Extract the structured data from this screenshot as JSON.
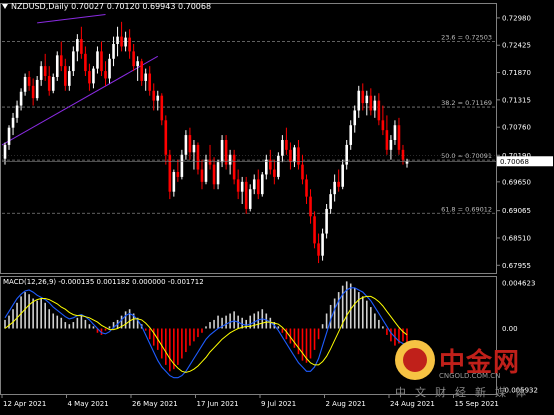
{
  "ticker": {
    "symbol": "NZDUSD,Daily",
    "open": "0.70027",
    "high": "0.70120",
    "low": "0.69943",
    "close": "0.70068"
  },
  "macd_label": "MACD(12,26,9) -0.000135 0.001182 0.000000 -0.001712",
  "colors": {
    "background": "#000000",
    "bull": "#ffffff",
    "bear": "#ff0000",
    "grid": "#808080",
    "trendline": "#8a2be2",
    "signal": "#ffff00",
    "macd_line": "#1e5cff",
    "fib": "#808080"
  },
  "price_axis": {
    "labels": [
      "0.72980",
      "0.72425",
      "0.71870",
      "0.71315",
      "0.70760",
      "0.70190",
      "0.69650",
      "0.69065",
      "0.68510",
      "0.67955"
    ],
    "current": "0.70068"
  },
  "macd_axis": {
    "labels": [
      "0.004623",
      "0.00",
      "-0.005932"
    ]
  },
  "fib_levels": [
    {
      "label": "23.6 = 0.72503"
    },
    {
      "label": "38.2 = 0.71169"
    },
    {
      "label": "50.0 = 0.70091"
    },
    {
      "label": "61.8 = 0.69012"
    }
  ],
  "date_axis": {
    "labels": [
      "12 Apr 2021",
      "4 May 2021",
      "26 May 2021",
      "17 Jun 2021",
      "9 Jul 2021",
      "2 Aug 2021",
      "24 Aug 2021",
      "15 Sep 2021"
    ]
  },
  "watermark": {
    "title": "中金网",
    "url": "CNGOLD.COM.CN",
    "tagline": "中文财经新媒体"
  },
  "chart_data": {
    "type": "candlestick",
    "symbol": "NZDUSD",
    "timeframe": "Daily",
    "ylim": [
      0.679,
      0.731
    ],
    "x": [
      "12 Apr 2021",
      "4 May 2021",
      "26 May 2021",
      "17 Jun 2021",
      "9 Jul 2021",
      "2 Aug 2021",
      "24 Aug 2021",
      "15 Sep 2021"
    ],
    "candles": [
      [
        0.7012,
        0.7045,
        0.7,
        0.704
      ],
      [
        0.704,
        0.708,
        0.703,
        0.7075
      ],
      [
        0.7075,
        0.7105,
        0.706,
        0.7095
      ],
      [
        0.7095,
        0.713,
        0.7085,
        0.712
      ],
      [
        0.712,
        0.7155,
        0.711,
        0.7148
      ],
      [
        0.7148,
        0.7185,
        0.714,
        0.7178
      ],
      [
        0.7178,
        0.719,
        0.715,
        0.716
      ],
      [
        0.716,
        0.7175,
        0.712,
        0.7135
      ],
      [
        0.7135,
        0.718,
        0.713,
        0.7172
      ],
      [
        0.7172,
        0.721,
        0.716,
        0.72
      ],
      [
        0.72,
        0.7225,
        0.717,
        0.718
      ],
      [
        0.718,
        0.72,
        0.714,
        0.715
      ],
      [
        0.715,
        0.7185,
        0.7145,
        0.7178
      ],
      [
        0.7178,
        0.723,
        0.717,
        0.7222
      ],
      [
        0.7222,
        0.725,
        0.719,
        0.72
      ],
      [
        0.72,
        0.7215,
        0.715,
        0.716
      ],
      [
        0.716,
        0.72,
        0.715,
        0.719
      ],
      [
        0.719,
        0.724,
        0.718,
        0.723
      ],
      [
        0.723,
        0.7265,
        0.721,
        0.7255
      ],
      [
        0.7255,
        0.728,
        0.7215,
        0.7225
      ],
      [
        0.7225,
        0.724,
        0.718,
        0.719
      ],
      [
        0.719,
        0.7205,
        0.715,
        0.7165
      ],
      [
        0.7165,
        0.72,
        0.7155,
        0.7195
      ],
      [
        0.7195,
        0.724,
        0.7185,
        0.723
      ],
      [
        0.723,
        0.725,
        0.718,
        0.719
      ],
      [
        0.719,
        0.721,
        0.716,
        0.7175
      ],
      [
        0.7175,
        0.7225,
        0.7165,
        0.7215
      ],
      [
        0.7215,
        0.726,
        0.72,
        0.7245
      ],
      [
        0.7245,
        0.728,
        0.722,
        0.726
      ],
      [
        0.726,
        0.729,
        0.723,
        0.724
      ],
      [
        0.724,
        0.727,
        0.723,
        0.7258
      ],
      [
        0.7258,
        0.7275,
        0.7215,
        0.723
      ],
      [
        0.723,
        0.7245,
        0.719,
        0.72
      ],
      [
        0.72,
        0.722,
        0.717,
        0.721
      ],
      [
        0.721,
        0.7215,
        0.716,
        0.717
      ],
      [
        0.717,
        0.7195,
        0.715,
        0.7185
      ],
      [
        0.7185,
        0.72,
        0.714,
        0.715
      ],
      [
        0.715,
        0.7165,
        0.711,
        0.713
      ],
      [
        0.713,
        0.715,
        0.711,
        0.714
      ],
      [
        0.714,
        0.7145,
        0.708,
        0.709
      ],
      [
        0.709,
        0.71,
        0.7,
        0.702
      ],
      [
        0.702,
        0.703,
        0.693,
        0.6945
      ],
      [
        0.6945,
        0.699,
        0.6935,
        0.6985
      ],
      [
        0.6985,
        0.701,
        0.6965,
        0.6975
      ],
      [
        0.6975,
        0.703,
        0.697,
        0.702
      ],
      [
        0.702,
        0.707,
        0.701,
        0.706
      ],
      [
        0.706,
        0.7075,
        0.701,
        0.7025
      ],
      [
        0.7025,
        0.705,
        0.699,
        0.704
      ],
      [
        0.704,
        0.7045,
        0.698,
        0.699
      ],
      [
        0.699,
        0.701,
        0.695,
        0.6965
      ],
      [
        0.6965,
        0.702,
        0.696,
        0.701
      ],
      [
        0.701,
        0.704,
        0.699,
        0.7
      ],
      [
        0.7,
        0.7015,
        0.695,
        0.696
      ],
      [
        0.696,
        0.701,
        0.695,
        0.7005
      ],
      [
        0.7005,
        0.706,
        0.6995,
        0.705
      ],
      [
        0.705,
        0.706,
        0.699,
        0.7
      ],
      [
        0.7,
        0.703,
        0.698,
        0.702
      ],
      [
        0.702,
        0.703,
        0.696,
        0.697
      ],
      [
        0.697,
        0.699,
        0.693,
        0.6945
      ],
      [
        0.6945,
        0.6975,
        0.692,
        0.6965
      ],
      [
        0.6965,
        0.6975,
        0.69,
        0.691
      ],
      [
        0.691,
        0.696,
        0.6905,
        0.695
      ],
      [
        0.695,
        0.698,
        0.694,
        0.697
      ],
      [
        0.697,
        0.699,
        0.693,
        0.694
      ],
      [
        0.694,
        0.6985,
        0.6935,
        0.698
      ],
      [
        0.698,
        0.702,
        0.697,
        0.701
      ],
      [
        0.701,
        0.703,
        0.698,
        0.699
      ],
      [
        0.699,
        0.701,
        0.696,
        0.6975
      ],
      [
        0.6975,
        0.7025,
        0.697,
        0.7018
      ],
      [
        0.7018,
        0.706,
        0.7005,
        0.705
      ],
      [
        0.705,
        0.7075,
        0.702,
        0.703
      ],
      [
        0.703,
        0.7045,
        0.699,
        0.7005
      ],
      [
        0.7005,
        0.704,
        0.6995,
        0.7035
      ],
      [
        0.7035,
        0.705,
        0.699,
        0.7
      ],
      [
        0.7,
        0.702,
        0.696,
        0.697
      ],
      [
        0.697,
        0.698,
        0.692,
        0.6935
      ],
      [
        0.6935,
        0.695,
        0.688,
        0.6895
      ],
      [
        0.6895,
        0.6905,
        0.683,
        0.684
      ],
      [
        0.684,
        0.686,
        0.68,
        0.6815
      ],
      [
        0.6815,
        0.687,
        0.6805,
        0.686
      ],
      [
        0.686,
        0.692,
        0.685,
        0.691
      ],
      [
        0.691,
        0.695,
        0.69,
        0.694
      ],
      [
        0.694,
        0.698,
        0.6925,
        0.6965
      ],
      [
        0.6965,
        0.699,
        0.6945,
        0.6955
      ],
      [
        0.6955,
        0.701,
        0.695,
        0.7
      ],
      [
        0.7,
        0.705,
        0.699,
        0.704
      ],
      [
        0.704,
        0.709,
        0.703,
        0.708
      ],
      [
        0.708,
        0.712,
        0.7065,
        0.711
      ],
      [
        0.711,
        0.716,
        0.7095,
        0.715
      ],
      [
        0.715,
        0.7165,
        0.711,
        0.7125
      ],
      [
        0.7125,
        0.715,
        0.71,
        0.714
      ],
      [
        0.714,
        0.7155,
        0.71,
        0.711
      ],
      [
        0.711,
        0.714,
        0.7095,
        0.713
      ],
      [
        0.713,
        0.7145,
        0.708,
        0.709
      ],
      [
        0.709,
        0.712,
        0.706,
        0.707
      ],
      [
        0.707,
        0.71,
        0.702,
        0.703
      ],
      [
        0.703,
        0.706,
        0.701,
        0.705
      ],
      [
        0.705,
        0.709,
        0.704,
        0.708
      ],
      [
        0.708,
        0.7095,
        0.702,
        0.703
      ],
      [
        0.703,
        0.704,
        0.7,
        0.701
      ],
      [
        0.7002,
        0.7012,
        0.6994,
        0.7007
      ]
    ],
    "fib_levels": [
      {
        "ratio": 23.6,
        "value": 0.72503
      },
      {
        "ratio": 38.2,
        "value": 0.71169
      },
      {
        "ratio": 50.0,
        "value": 0.70091
      },
      {
        "ratio": 61.8,
        "value": 0.69012
      }
    ],
    "macd": {
      "params": "12,26,9",
      "ylim": [
        -0.005932,
        0.004623
      ],
      "histogram": [
        0.0008,
        0.0012,
        0.0018,
        0.0024,
        0.003,
        0.0034,
        0.0032,
        0.0028,
        0.0026,
        0.0028,
        0.0024,
        0.0018,
        0.0014,
        0.0012,
        0.001,
        0.0006,
        0.0004,
        0.0006,
        0.001,
        0.0012,
        0.0008,
        0.0004,
        0.0002,
        -0.0004,
        -0.0006,
        -0.0002,
        0.0002,
        0.0006,
        0.0008,
        0.0012,
        0.0016,
        0.0018,
        0.0014,
        0.001,
        0.0004,
        -0.0002,
        -0.001,
        -0.0016,
        -0.002,
        -0.0028,
        -0.0034,
        -0.004,
        -0.0038,
        -0.0034,
        -0.0028,
        -0.0022,
        -0.0016,
        -0.0012,
        -0.0008,
        -0.0004,
        0.0002,
        0.0006,
        0.0008,
        0.0012,
        0.001,
        0.0012,
        0.0014,
        0.0016,
        0.0012,
        0.001,
        0.0008,
        0.0012,
        0.0014,
        0.0016,
        0.0018,
        0.0014,
        0.001,
        0.0006,
        0.0002,
        -0.0004,
        -0.001,
        -0.0014,
        -0.0018,
        -0.0024,
        -0.003,
        -0.0032,
        -0.0028,
        -0.002,
        -0.001,
        0.0004,
        0.0014,
        0.0022,
        0.0028,
        0.0034,
        0.004,
        0.0044,
        0.0042,
        0.0038,
        0.0034,
        0.003,
        0.0026,
        0.002,
        0.0014,
        0.0008,
        0.0002,
        -0.0006,
        -0.0012,
        -0.0016,
        -0.0014,
        -0.0012,
        -0.0017
      ],
      "macd_line": [
        0.001,
        0.0016,
        0.0022,
        0.0028,
        0.0032,
        0.0035,
        0.0036,
        0.0034,
        0.0031,
        0.0029,
        0.0027,
        0.0024,
        0.002,
        0.0017,
        0.0014,
        0.0011,
        0.0009,
        0.001,
        0.0012,
        0.0013,
        0.0011,
        0.0008,
        0.0004,
        0.0,
        -0.0004,
        -0.0005,
        -0.0003,
        0.0001,
        0.0004,
        0.0008,
        0.0012,
        0.0014,
        0.0012,
        0.0008,
        0.0002,
        -0.0006,
        -0.0014,
        -0.0022,
        -0.003,
        -0.0036,
        -0.004,
        -0.0044,
        -0.0046,
        -0.0046,
        -0.0044,
        -0.004,
        -0.0034,
        -0.0028,
        -0.0022,
        -0.0016,
        -0.001,
        -0.0006,
        -0.0003,
        0.0,
        0.0002,
        0.0004,
        0.0006,
        0.0007,
        0.0006,
        0.0004,
        0.0003,
        0.0004,
        0.0006,
        0.0008,
        0.0009,
        0.0008,
        0.0006,
        0.0003,
        -0.0002,
        -0.0008,
        -0.0014,
        -0.002,
        -0.0026,
        -0.0032,
        -0.0036,
        -0.004,
        -0.004,
        -0.0036,
        -0.0028,
        -0.0016,
        -0.0004,
        0.0008,
        0.0018,
        0.0026,
        0.0032,
        0.0036,
        0.0038,
        0.0038,
        0.0036,
        0.0034,
        0.003,
        0.0026,
        0.002,
        0.0014,
        0.0008,
        0.0002,
        -0.0004,
        -0.0008,
        -0.0012,
        -0.0014,
        -0.0016
      ],
      "signal_line": [
        0.0,
        0.0003,
        0.0006,
        0.001,
        0.0014,
        0.0018,
        0.0022,
        0.0025,
        0.0027,
        0.0028,
        0.0028,
        0.0027,
        0.0025,
        0.0023,
        0.002,
        0.0018,
        0.0015,
        0.0013,
        0.0012,
        0.0012,
        0.0011,
        0.001,
        0.0008,
        0.0006,
        0.0003,
        0.0001,
        -0.0001,
        -0.0001,
        0.0,
        0.0002,
        0.0004,
        0.0007,
        0.0009,
        0.0009,
        0.0008,
        0.0005,
        0.0001,
        -0.0004,
        -0.001,
        -0.0016,
        -0.0022,
        -0.0028,
        -0.0033,
        -0.0037,
        -0.004,
        -0.0041,
        -0.004,
        -0.0038,
        -0.0035,
        -0.0031,
        -0.0027,
        -0.0022,
        -0.0018,
        -0.0014,
        -0.001,
        -0.0007,
        -0.0004,
        -0.0002,
        0.0,
        0.0001,
        0.0002,
        0.0002,
        0.0003,
        0.0004,
        0.0005,
        0.0006,
        0.0006,
        0.0005,
        0.0004,
        0.0001,
        -0.0003,
        -0.0008,
        -0.0013,
        -0.0018,
        -0.0023,
        -0.0028,
        -0.0032,
        -0.0034,
        -0.0034,
        -0.0031,
        -0.0026,
        -0.0019,
        -0.0011,
        -0.0003,
        0.0005,
        0.0012,
        0.0018,
        0.0023,
        0.0027,
        0.0029,
        0.003,
        0.003,
        0.0028,
        0.0025,
        0.0021,
        0.0016,
        0.0011,
        0.0006,
        0.0001,
        -0.0003,
        -0.0006
      ]
    }
  }
}
